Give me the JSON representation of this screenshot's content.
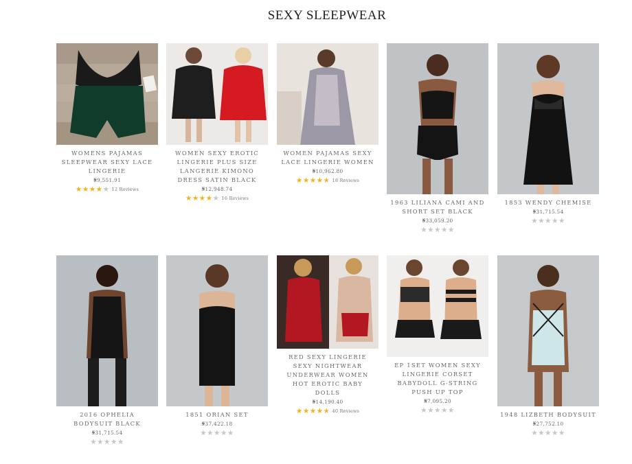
{
  "page": {
    "title": "SEXY SLEEPWEAR"
  },
  "products": [
    {
      "name": "WOMENS PAJAMAS SLEEPWEAR SEXY LACE LINGERIE",
      "price": "₦9,551.91",
      "rating": 4,
      "reviews": "12 Reviews"
    },
    {
      "name": "WOMEN SEXY EROTIC LINGERIE PLUS SIZE LANGERIE KIMONO DRESS SATIN BLACK",
      "price": "₦12,948.74",
      "rating": 4,
      "reviews": "16 Reviews"
    },
    {
      "name": "WOMEN PAJAMAS SEXY LACE LINGERIE WOMEN",
      "price": "₦10,962.80",
      "rating": 4.5,
      "reviews": "18 Reviews"
    },
    {
      "name": "1963 LILIANA CAMI AND SHORT SET BLACK",
      "price": "₦33,059.20",
      "rating": 0,
      "reviews": ""
    },
    {
      "name": "1853 WENDY CHEMISE",
      "price": "₦31,715.54",
      "rating": 0,
      "reviews": ""
    },
    {
      "name": "2016 OPHELIA BODYSUIT BLACK",
      "price": "₦31,715.54",
      "rating": 0,
      "reviews": ""
    },
    {
      "name": "1851 ORIAN SET",
      "price": "₦37,422.18",
      "rating": 0,
      "reviews": ""
    },
    {
      "name": "RED SEXY LINGERIE SEXY NIGHTWEAR UNDERWEAR WOMEN HOT EROTIC BABY DOLLS",
      "price": "₦14,190.40",
      "rating": 4.5,
      "reviews": "40 Reviews"
    },
    {
      "name": "EP 1SET WOMEN SEXY LINGERIE CORSET BABYDOLL G-STRING PUSH UP TOP",
      "price": "₦7,095.20",
      "rating": 0,
      "reviews": ""
    },
    {
      "name": "1948 LIZBETH BODYSUIT",
      "price": "₦27,752.10",
      "rating": 0,
      "reviews": ""
    }
  ],
  "colors": {
    "star_filled": "#f3b118",
    "star_empty": "#c3c7cc"
  }
}
